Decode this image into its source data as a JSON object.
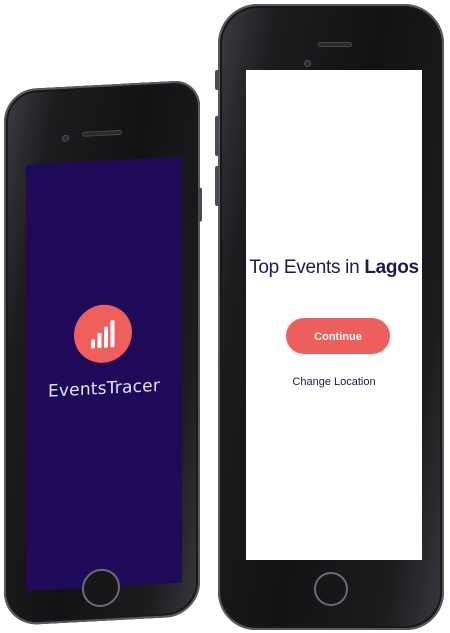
{
  "left_phone": {
    "screen_background": "#1f0a59",
    "app_name": "EventsTracer",
    "logo_icon": "bar-chart-icon",
    "logo_color": "#ef5f5b"
  },
  "right_phone": {
    "screen_background": "#ffffff",
    "title_prefix": "Top Events in",
    "title_city": "Lagos",
    "continue_label": "Continue",
    "change_location_label": "Change Location",
    "accent_color": "#ec5f5d"
  }
}
